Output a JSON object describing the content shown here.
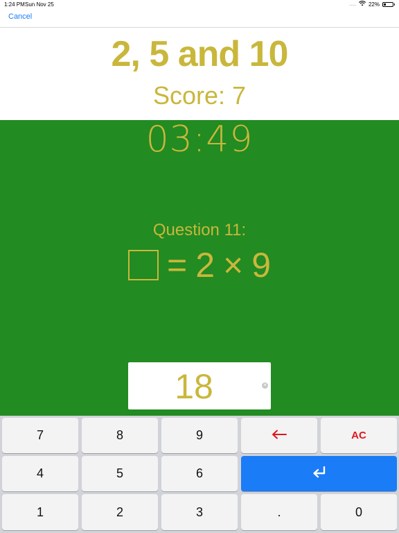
{
  "status": {
    "time": "1:24 PM",
    "date": "Sun Nov 25",
    "signal_dots": ".....",
    "battery_percent": "22%"
  },
  "nav": {
    "cancel_label": "Cancel"
  },
  "header": {
    "title": "2, 5 and 10",
    "score": "Score: 7"
  },
  "timer": "03:49",
  "question": {
    "label": "Question 11:",
    "equals": "=",
    "operand1": "2",
    "operator": "×",
    "operand2": "9"
  },
  "answer": {
    "value": "18"
  },
  "keypad": {
    "row1": [
      "7",
      "8",
      "9",
      "←",
      "AC"
    ],
    "row2": [
      "4",
      "5",
      "6",
      "↵"
    ],
    "row3": [
      "1",
      "2",
      "3",
      ".",
      "0"
    ]
  },
  "colors": {
    "accent_gold": "#c9b73c",
    "green": "#228b22",
    "blue": "#1a7cf6",
    "red": "#e0161c"
  }
}
